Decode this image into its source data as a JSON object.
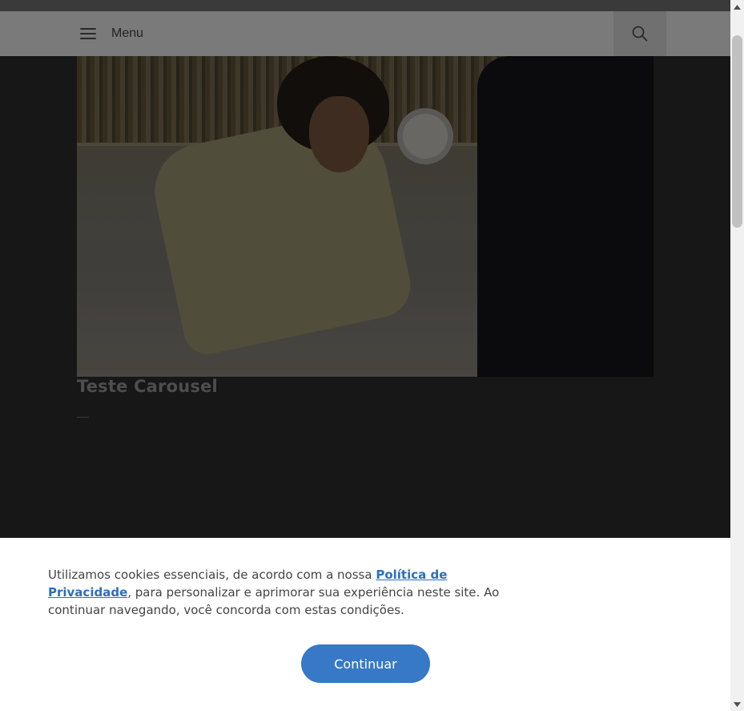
{
  "header": {
    "menu_label": "Menu",
    "menu_icon": "hamburger-icon",
    "search_icon": "search-icon"
  },
  "post": {
    "title": "Teste Carousel"
  },
  "cookie_banner": {
    "text_before_link": "Utilizamos cookies essenciais, de acordo com a nossa ",
    "link_text": "Política de Privacidade",
    "text_after_link": ", para personalizar e aprimorar sua experiência neste site. Ao continuar navegando, você concorda com estas condições.",
    "button_label": "Continuar"
  },
  "colors": {
    "accent": "#3779c6",
    "link": "#2a6fbf",
    "background": "#171718"
  }
}
